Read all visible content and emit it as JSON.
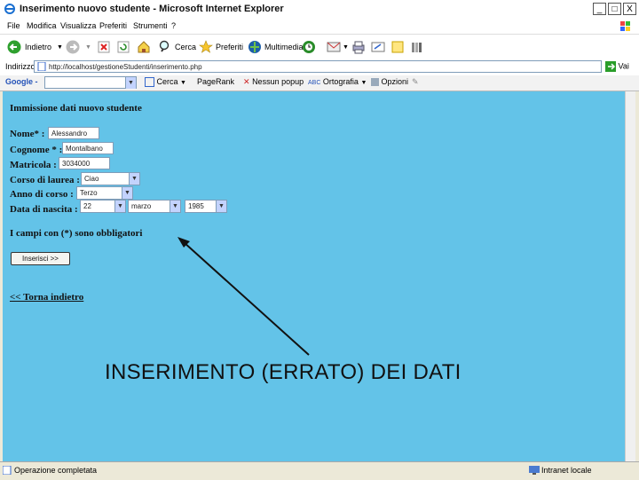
{
  "window": {
    "title": "Inserimento nuovo studente - Microsoft Internet Explorer",
    "minimize": "_",
    "maximize": "□",
    "close": "X"
  },
  "menu": [
    "File",
    "Modifica",
    "Visualizza",
    "Preferiti",
    "Strumenti",
    "?"
  ],
  "toolbar": {
    "back_label": "Indietro",
    "search_label": "Cerca",
    "favorites_label": "Preferiti",
    "multimedia_label": "Multimedia"
  },
  "address": {
    "label": "Indirizzo",
    "url": "http://localhost/gestioneStudenti/inserimento.php",
    "go_label": "Vai"
  },
  "google_bar": {
    "brand": "Google -",
    "search_label": "Cerca",
    "pagerank_label": "PageRank",
    "popup_label": "Nessun popup",
    "spell_label": "Ortografia",
    "options_label": "Opzioni"
  },
  "form": {
    "heading": "Immissione dati nuovo studente",
    "nome_label": "Nome* :",
    "nome_value": "Alessandro",
    "cognome_label": "Cognome * :",
    "cognome_value": "Montalbano",
    "matricola_label": "Matricola :",
    "matricola_value": "3034000",
    "corso_label": "Corso di laurea :",
    "corso_value": "Ciao",
    "anno_label": "Anno di corso :",
    "anno_value": "Terzo",
    "nascita_label": "Data di nascita :",
    "giorno_value": "22",
    "mese_value": "marzo",
    "anno_nascita_value": "1985",
    "required_note": "I campi con (*) sono obbligatori",
    "submit_label": "Inserisci >>",
    "back_link": "<< Torna indietro"
  },
  "annotation": {
    "caption": "INSERIMENTO (ERRATO) DEI DATI"
  },
  "status": {
    "text": "Operazione completata",
    "zone": "Intranet locale"
  },
  "icons": [
    "ie-logo-icon",
    "back-arrow-icon",
    "forward-arrow-icon",
    "stop-icon",
    "refresh-icon",
    "home-icon",
    "search-icon",
    "favorites-star-icon",
    "multimedia-icon",
    "history-icon",
    "mail-icon",
    "print-icon",
    "edit-icon",
    "messenger-icon",
    "research-icon",
    "page-icon",
    "go-arrow-icon",
    "windows-logo-icon",
    "status-page-icon",
    "intranet-icon"
  ],
  "colors": {
    "page_background": "#63c3e8",
    "go_button": "#2a9d2a"
  }
}
